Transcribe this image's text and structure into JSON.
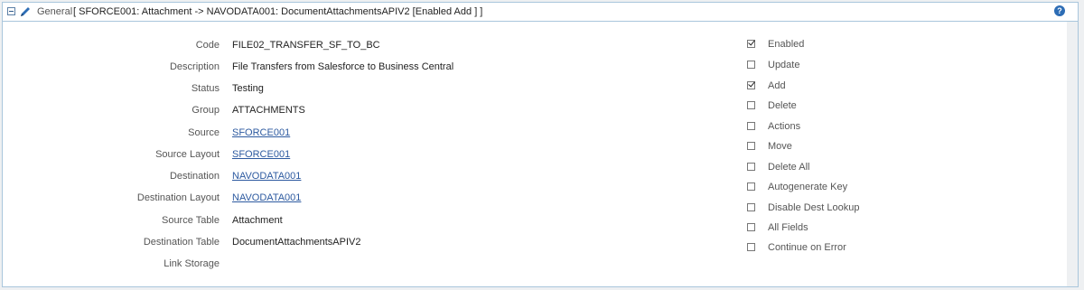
{
  "header": {
    "section_label": "General",
    "title": "[ SFORCE001: Attachment -> NAVODATA001: DocumentAttachmentsAPIV2 [Enabled Add ] ]",
    "help_label": "?"
  },
  "fields": [
    {
      "label": "Code",
      "value": "FILE02_TRANSFER_SF_TO_BC",
      "link": false
    },
    {
      "label": "Description",
      "value": "File Transfers from Salesforce to Business Central",
      "link": false
    },
    {
      "label": "Status",
      "value": "Testing",
      "link": false
    },
    {
      "label": "Group",
      "value": "ATTACHMENTS",
      "link": false
    },
    {
      "label": "Source",
      "value": "SFORCE001",
      "link": true
    },
    {
      "label": "Source Layout",
      "value": "SFORCE001",
      "link": true
    },
    {
      "label": "Destination",
      "value": "NAVODATA001",
      "link": true
    },
    {
      "label": "Destination Layout",
      "value": "NAVODATA001",
      "link": true
    },
    {
      "label": "Source Table",
      "value": "Attachment",
      "link": false
    },
    {
      "label": "Destination Table",
      "value": "DocumentAttachmentsAPIV2",
      "link": false
    },
    {
      "label": "Link Storage",
      "value": "",
      "link": false
    }
  ],
  "options": [
    {
      "label": "Enabled",
      "checked": true
    },
    {
      "label": "Update",
      "checked": false
    },
    {
      "label": "Add",
      "checked": true
    },
    {
      "label": "Delete",
      "checked": false
    },
    {
      "label": "Actions",
      "checked": false
    },
    {
      "label": "Move",
      "checked": false
    },
    {
      "label": "Delete All",
      "checked": false
    },
    {
      "label": "Autogenerate Key",
      "checked": false
    },
    {
      "label": "Disable Dest Lookup",
      "checked": false
    },
    {
      "label": "All Fields",
      "checked": false
    },
    {
      "label": "Continue on Error",
      "checked": false
    }
  ]
}
